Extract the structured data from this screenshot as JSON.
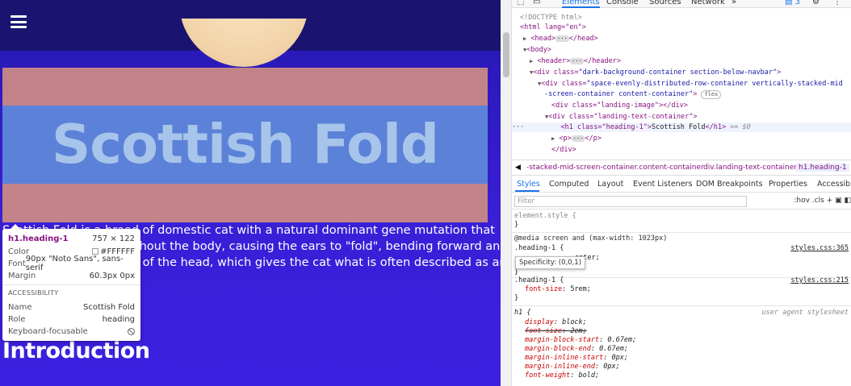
{
  "page": {
    "heading": "Scottish Fold",
    "paragraph_lines": [
      "Scottish Fold is a breed of domestic cat with a natural dominant gene mutation that",
      "affects cartilage throughout the body, causing the ears to \"fold\", bending forward and",
      "down towards the front of the head, which gives the cat what is often described as an"
    ],
    "intro_heading": "Introduction"
  },
  "tooltip": {
    "tag": "h1.heading-1",
    "size": "757 × 122",
    "color_label": "Color",
    "color_value": "#FFFFFF",
    "font_label": "Font",
    "font_value": "90px \"Noto Sans\", sans-serif",
    "margin_label": "Margin",
    "margin_value": "60.3px 0px",
    "section": "ACCESSIBILITY",
    "name_label": "Name",
    "name_value": "Scottish Fold",
    "role_label": "Role",
    "role_value": "heading",
    "kb_label": "Keyboard-focusable"
  },
  "devtools": {
    "tabs": [
      "Elements",
      "Console",
      "Sources",
      "Network",
      "»"
    ],
    "issues_count": "3",
    "elements": {
      "doctype": "<!DOCTYPE html>",
      "html_open": "<html lang=\"en\">",
      "head": "<head>",
      "head_close": "</head>",
      "body_open": "<body>",
      "header": "<header>",
      "header_close": "</header>",
      "div1_tag": "<div class=",
      "div1_val": "\"dark-background-container section-below-navbar\"",
      "div2_tag": "<div class=",
      "div2_val_1": "\"space-evenly-distributed-row-container vertically-stacked-mid",
      "div2_val_2": "-screen-container content-container\"",
      "flex_pill": "flex",
      "div3": "<div class=\"landing-image\"></div>",
      "div4": "<div class=\"landing-text-container\">",
      "h1_open": "<h1 class=\"heading-1\">",
      "h1_text": "Scottish Fold",
      "h1_close": "</h1>",
      "h1_marker": "== $0",
      "p_open": "<p>",
      "p_close": "</p>",
      "div_close": "</div>"
    },
    "breadcrumbs": [
      "-stacked-mid-screen-container.content-container",
      "div.landing-text-container",
      "h1.heading-1"
    ],
    "subtabs": [
      "Styles",
      "Computed",
      "Layout",
      "Event Listeners",
      "DOM Breakpoints",
      "Properties",
      "Accessibili"
    ],
    "filter_placeholder": "Filter",
    "filter_tools": ":hov  .cls  +",
    "styles": {
      "element_style": "element.style {",
      "close_brace": "}",
      "media_query": "@media screen and (max-width: 1023px)",
      "rule1_selector": ".heading-1 {",
      "rule1_src": "styles.css:365",
      "rule1_partial": "enter;",
      "specificity": "Specificity: (0,0,1)",
      "rule2_selector": ".heading-1 {",
      "rule2_src": "styles.css:215",
      "rule2_prop": "font-size",
      "rule2_val": "5rem;",
      "ua_selector": "h1 {",
      "ua_label": "user agent stylesheet",
      "ua_props": [
        {
          "prop": "display",
          "val": "block;",
          "strike": false
        },
        {
          "prop": "font-size",
          "val": "2em;",
          "strike": true
        },
        {
          "prop": "margin-block-start",
          "val": "0.67em;",
          "strike": false
        },
        {
          "prop": "margin-block-end",
          "val": "0.67em;",
          "strike": false
        },
        {
          "prop": "margin-inline-start",
          "val": "0px;",
          "strike": false
        },
        {
          "prop": "margin-inline-end",
          "val": "0px;",
          "strike": false
        },
        {
          "prop": "font-weight",
          "val": "bold;",
          "strike": false
        }
      ]
    }
  }
}
